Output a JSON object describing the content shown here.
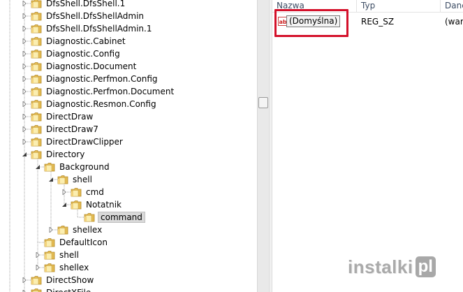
{
  "tree": {
    "items": [
      {
        "label": "DfsShell.DfsShell.1",
        "depth": 0,
        "expander": "collapsed"
      },
      {
        "label": "DfsShell.DfsShellAdmin",
        "depth": 0,
        "expander": "collapsed"
      },
      {
        "label": "DfsShell.DfsShellAdmin.1",
        "depth": 0,
        "expander": "collapsed"
      },
      {
        "label": "Diagnostic.Cabinet",
        "depth": 0,
        "expander": "collapsed"
      },
      {
        "label": "Diagnostic.Config",
        "depth": 0,
        "expander": "collapsed"
      },
      {
        "label": "Diagnostic.Document",
        "depth": 0,
        "expander": "collapsed"
      },
      {
        "label": "Diagnostic.Perfmon.Config",
        "depth": 0,
        "expander": "collapsed"
      },
      {
        "label": "Diagnostic.Perfmon.Document",
        "depth": 0,
        "expander": "collapsed"
      },
      {
        "label": "Diagnostic.Resmon.Config",
        "depth": 0,
        "expander": "collapsed"
      },
      {
        "label": "DirectDraw",
        "depth": 0,
        "expander": "collapsed"
      },
      {
        "label": "DirectDraw7",
        "depth": 0,
        "expander": "collapsed"
      },
      {
        "label": "DirectDrawClipper",
        "depth": 0,
        "expander": "collapsed"
      },
      {
        "label": "Directory",
        "depth": 0,
        "expander": "expanded"
      },
      {
        "label": "Background",
        "depth": 1,
        "expander": "expanded"
      },
      {
        "label": "shell",
        "depth": 2,
        "expander": "expanded"
      },
      {
        "label": "cmd",
        "depth": 3,
        "expander": "collapsed"
      },
      {
        "label": "Notatnik",
        "depth": 3,
        "expander": "expanded"
      },
      {
        "label": "command",
        "depth": 4,
        "expander": "none",
        "selected": true
      },
      {
        "label": "shellex",
        "depth": 2,
        "expander": "collapsed"
      },
      {
        "label": "DefaultIcon",
        "depth": 1,
        "expander": "none"
      },
      {
        "label": "shell",
        "depth": 1,
        "expander": "collapsed"
      },
      {
        "label": "shellex",
        "depth": 1,
        "expander": "collapsed"
      },
      {
        "label": "DirectShow",
        "depth": 0,
        "expander": "collapsed"
      },
      {
        "label": "DirectXFile",
        "depth": 0,
        "expander": "collapsed"
      }
    ]
  },
  "list": {
    "columns": [
      "Nazwa",
      "Typ",
      "Dane"
    ],
    "rows": [
      {
        "name": "(Domyślna)",
        "type": "REG_SZ",
        "data": "(wart"
      }
    ],
    "icon": "reg-sz-string-icon"
  },
  "watermark": {
    "text": "instalki",
    "suffix": "pl"
  },
  "colors": {
    "highlight": "#d4102a",
    "folder": "#e8c560",
    "selection": "#d9d9d9"
  }
}
